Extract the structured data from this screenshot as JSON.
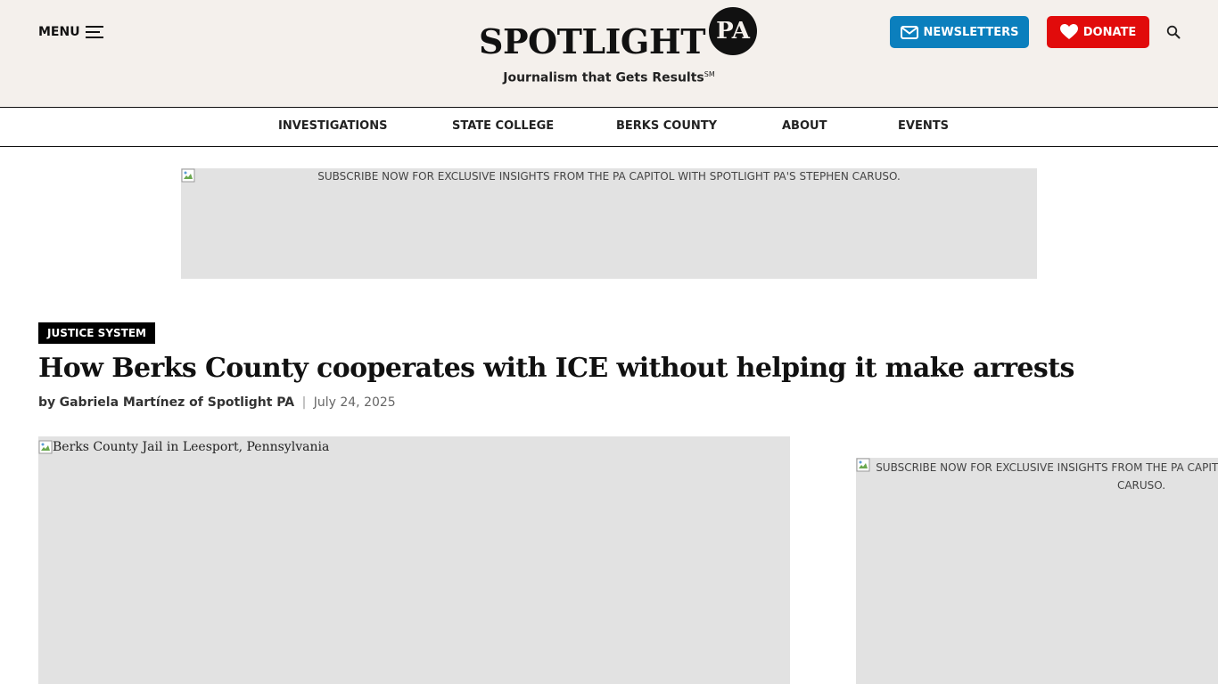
{
  "header": {
    "menu_label": "MENU",
    "logo_text": "SPOTLIGHT",
    "logo_badge": "PA",
    "tagline": "Journalism that Gets Results",
    "tagline_mark": "SM",
    "newsletters_label": "NEWSLETTERS",
    "donate_label": "DONATE",
    "colors": {
      "background": "#f4f0ec",
      "newsletters": "#0b7fbd",
      "donate": "#e10b0b"
    }
  },
  "nav": {
    "items": [
      {
        "label": "INVESTIGATIONS"
      },
      {
        "label": "STATE COLLEGE"
      },
      {
        "label": "BERKS COUNTY"
      },
      {
        "label": "ABOUT"
      },
      {
        "label": "EVENTS"
      }
    ]
  },
  "ad_banner": {
    "alt_text": "SUBSCRIBE NOW FOR EXCLUSIVE INSIGHTS FROM THE PA CAPITOL WITH SPOTLIGHT PA'S STEPHEN CARUSO."
  },
  "article": {
    "category": "JUSTICE SYSTEM",
    "headline": "How Berks County cooperates with ICE without helping it make arrests",
    "byline_prefix": "by",
    "author": "Gabriela Martínez of Spotlight PA",
    "separator": "|",
    "date": "July 24, 2025",
    "hero_alt": "Berks County Jail in Leesport, Pennsylvania"
  },
  "side_ad": {
    "alt_text": "SUBSCRIBE NOW FOR EXCLUSIVE INSIGHTS FROM THE PA CAPITOL WITH SPOTLIGHT PA'S STEPHEN CARUSO."
  }
}
